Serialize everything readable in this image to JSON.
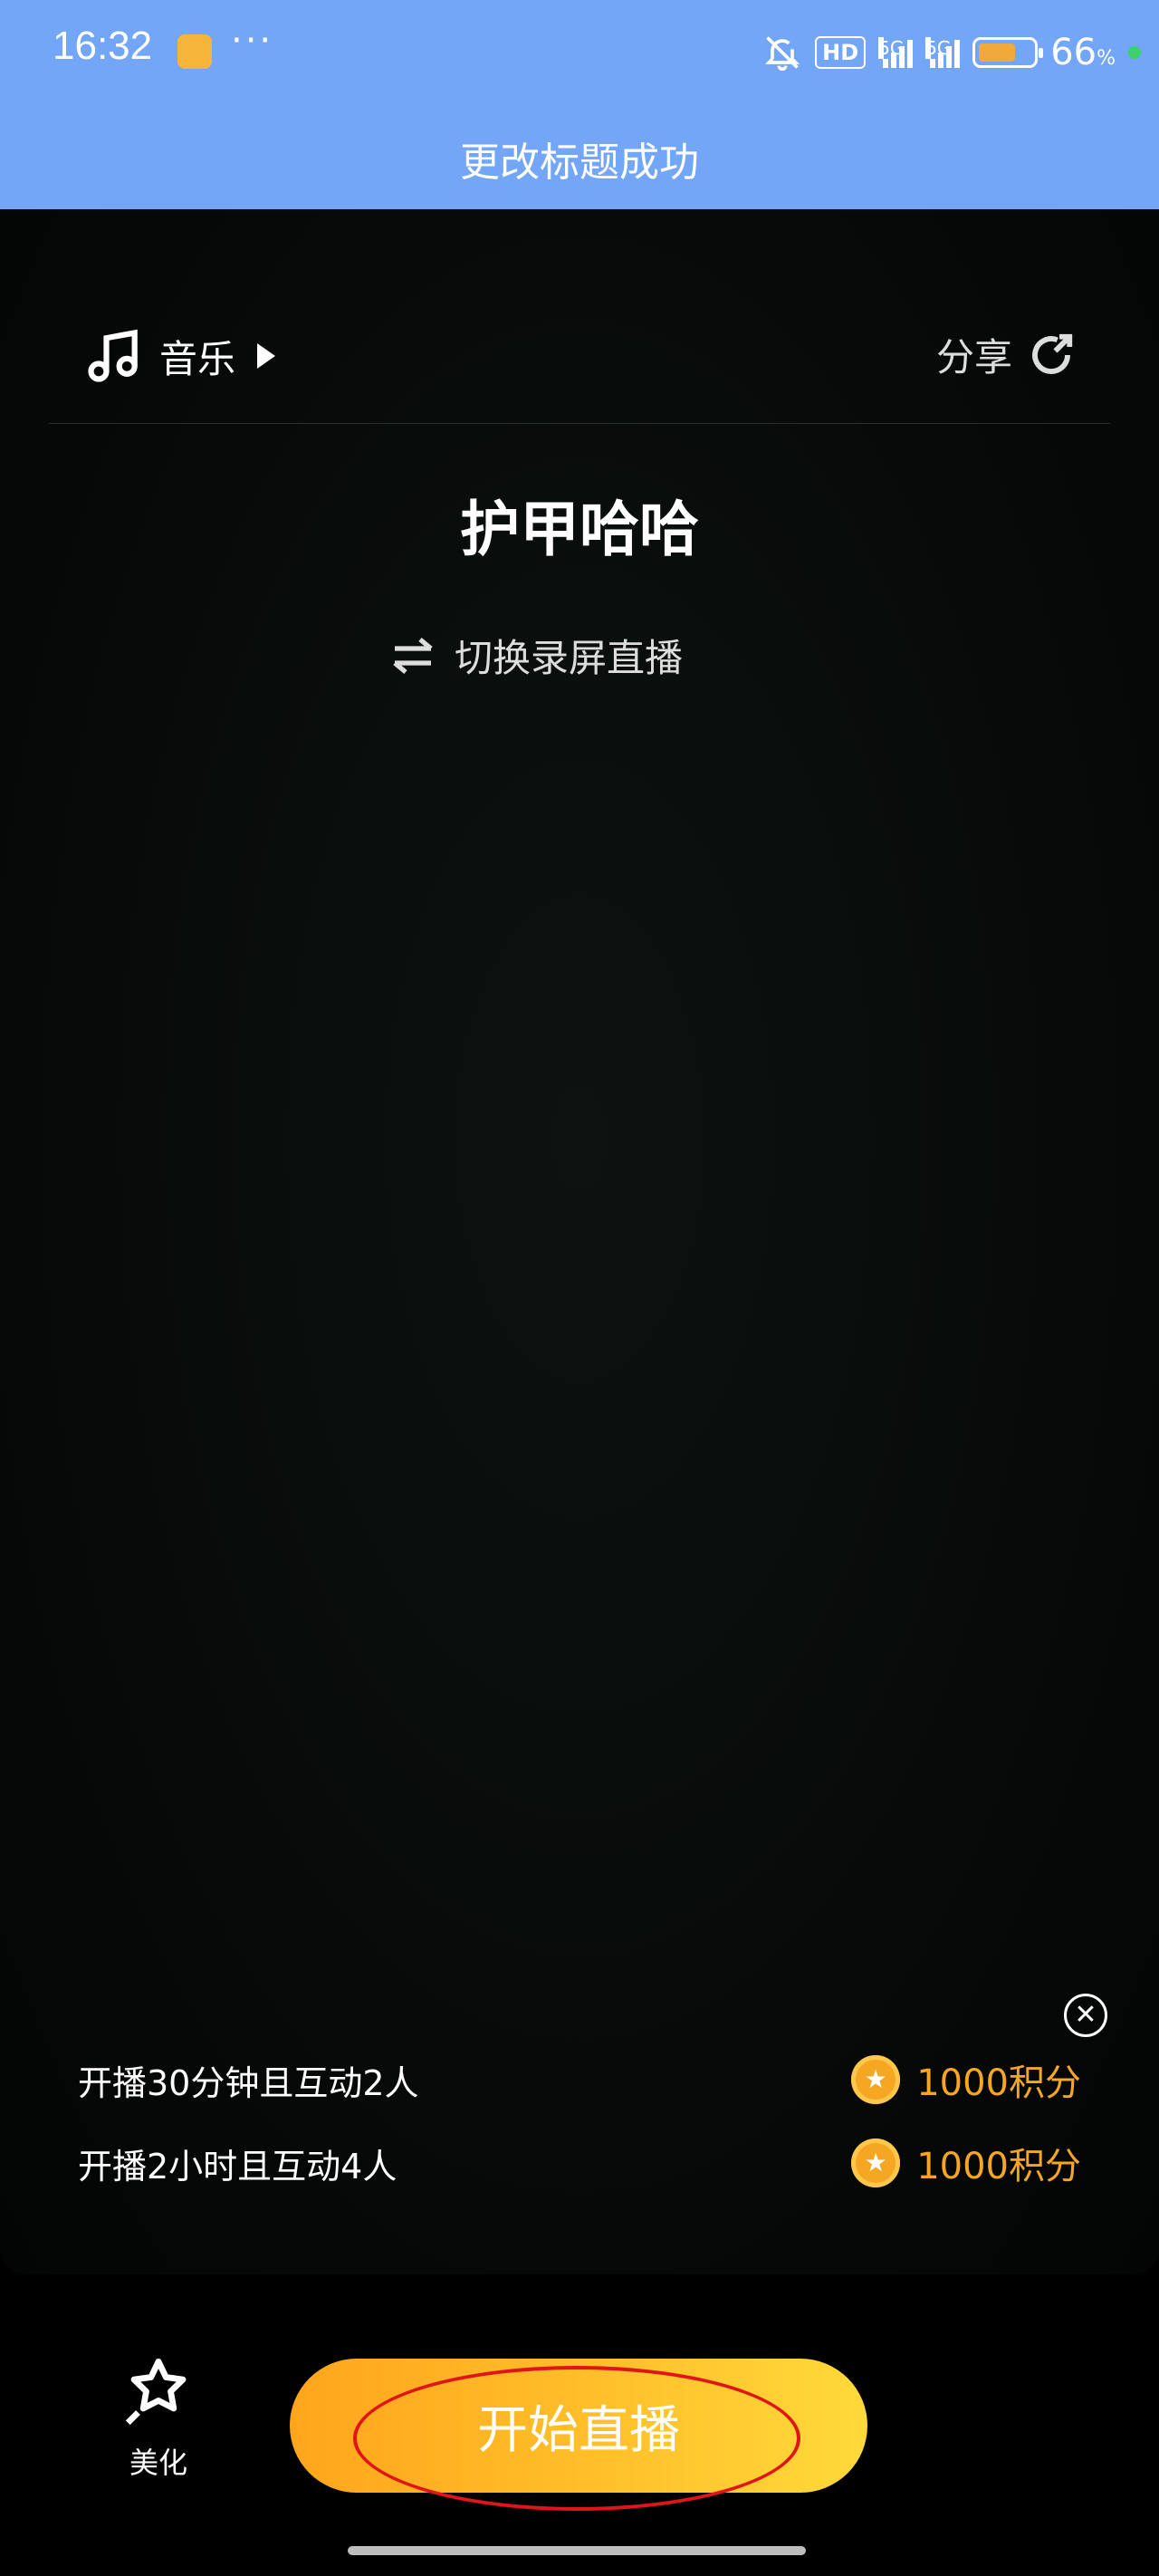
{
  "status_bar": {
    "time": "16:32",
    "hd_label": "HD",
    "signal_1_label": "5G",
    "signal_2_label": "5G",
    "battery_percent": "66",
    "battery_unit": "%"
  },
  "toast": {
    "text": "更改标题成功"
  },
  "toolbar": {
    "music_label": "音乐",
    "share_label": "分享"
  },
  "live": {
    "title": "护甲哈哈",
    "switch_label": "切换录屏直播"
  },
  "tasks": [
    {
      "text": "开播30分钟且互动2人",
      "reward": "1000积分"
    },
    {
      "text": "开播2小时且互动4人",
      "reward": "1000积分"
    }
  ],
  "bottom": {
    "beauty_label": "美化",
    "start_label": "开始直播"
  },
  "colors": {
    "header_blue": "#73a6f7",
    "accent_orange": "#f5a623",
    "highlight_red": "#e0151a"
  },
  "icons": [
    "bell-off-icon",
    "music-note-icon",
    "play-icon",
    "share-icon",
    "switch-icon",
    "close-icon",
    "coin-icon",
    "beauty-icon"
  ]
}
